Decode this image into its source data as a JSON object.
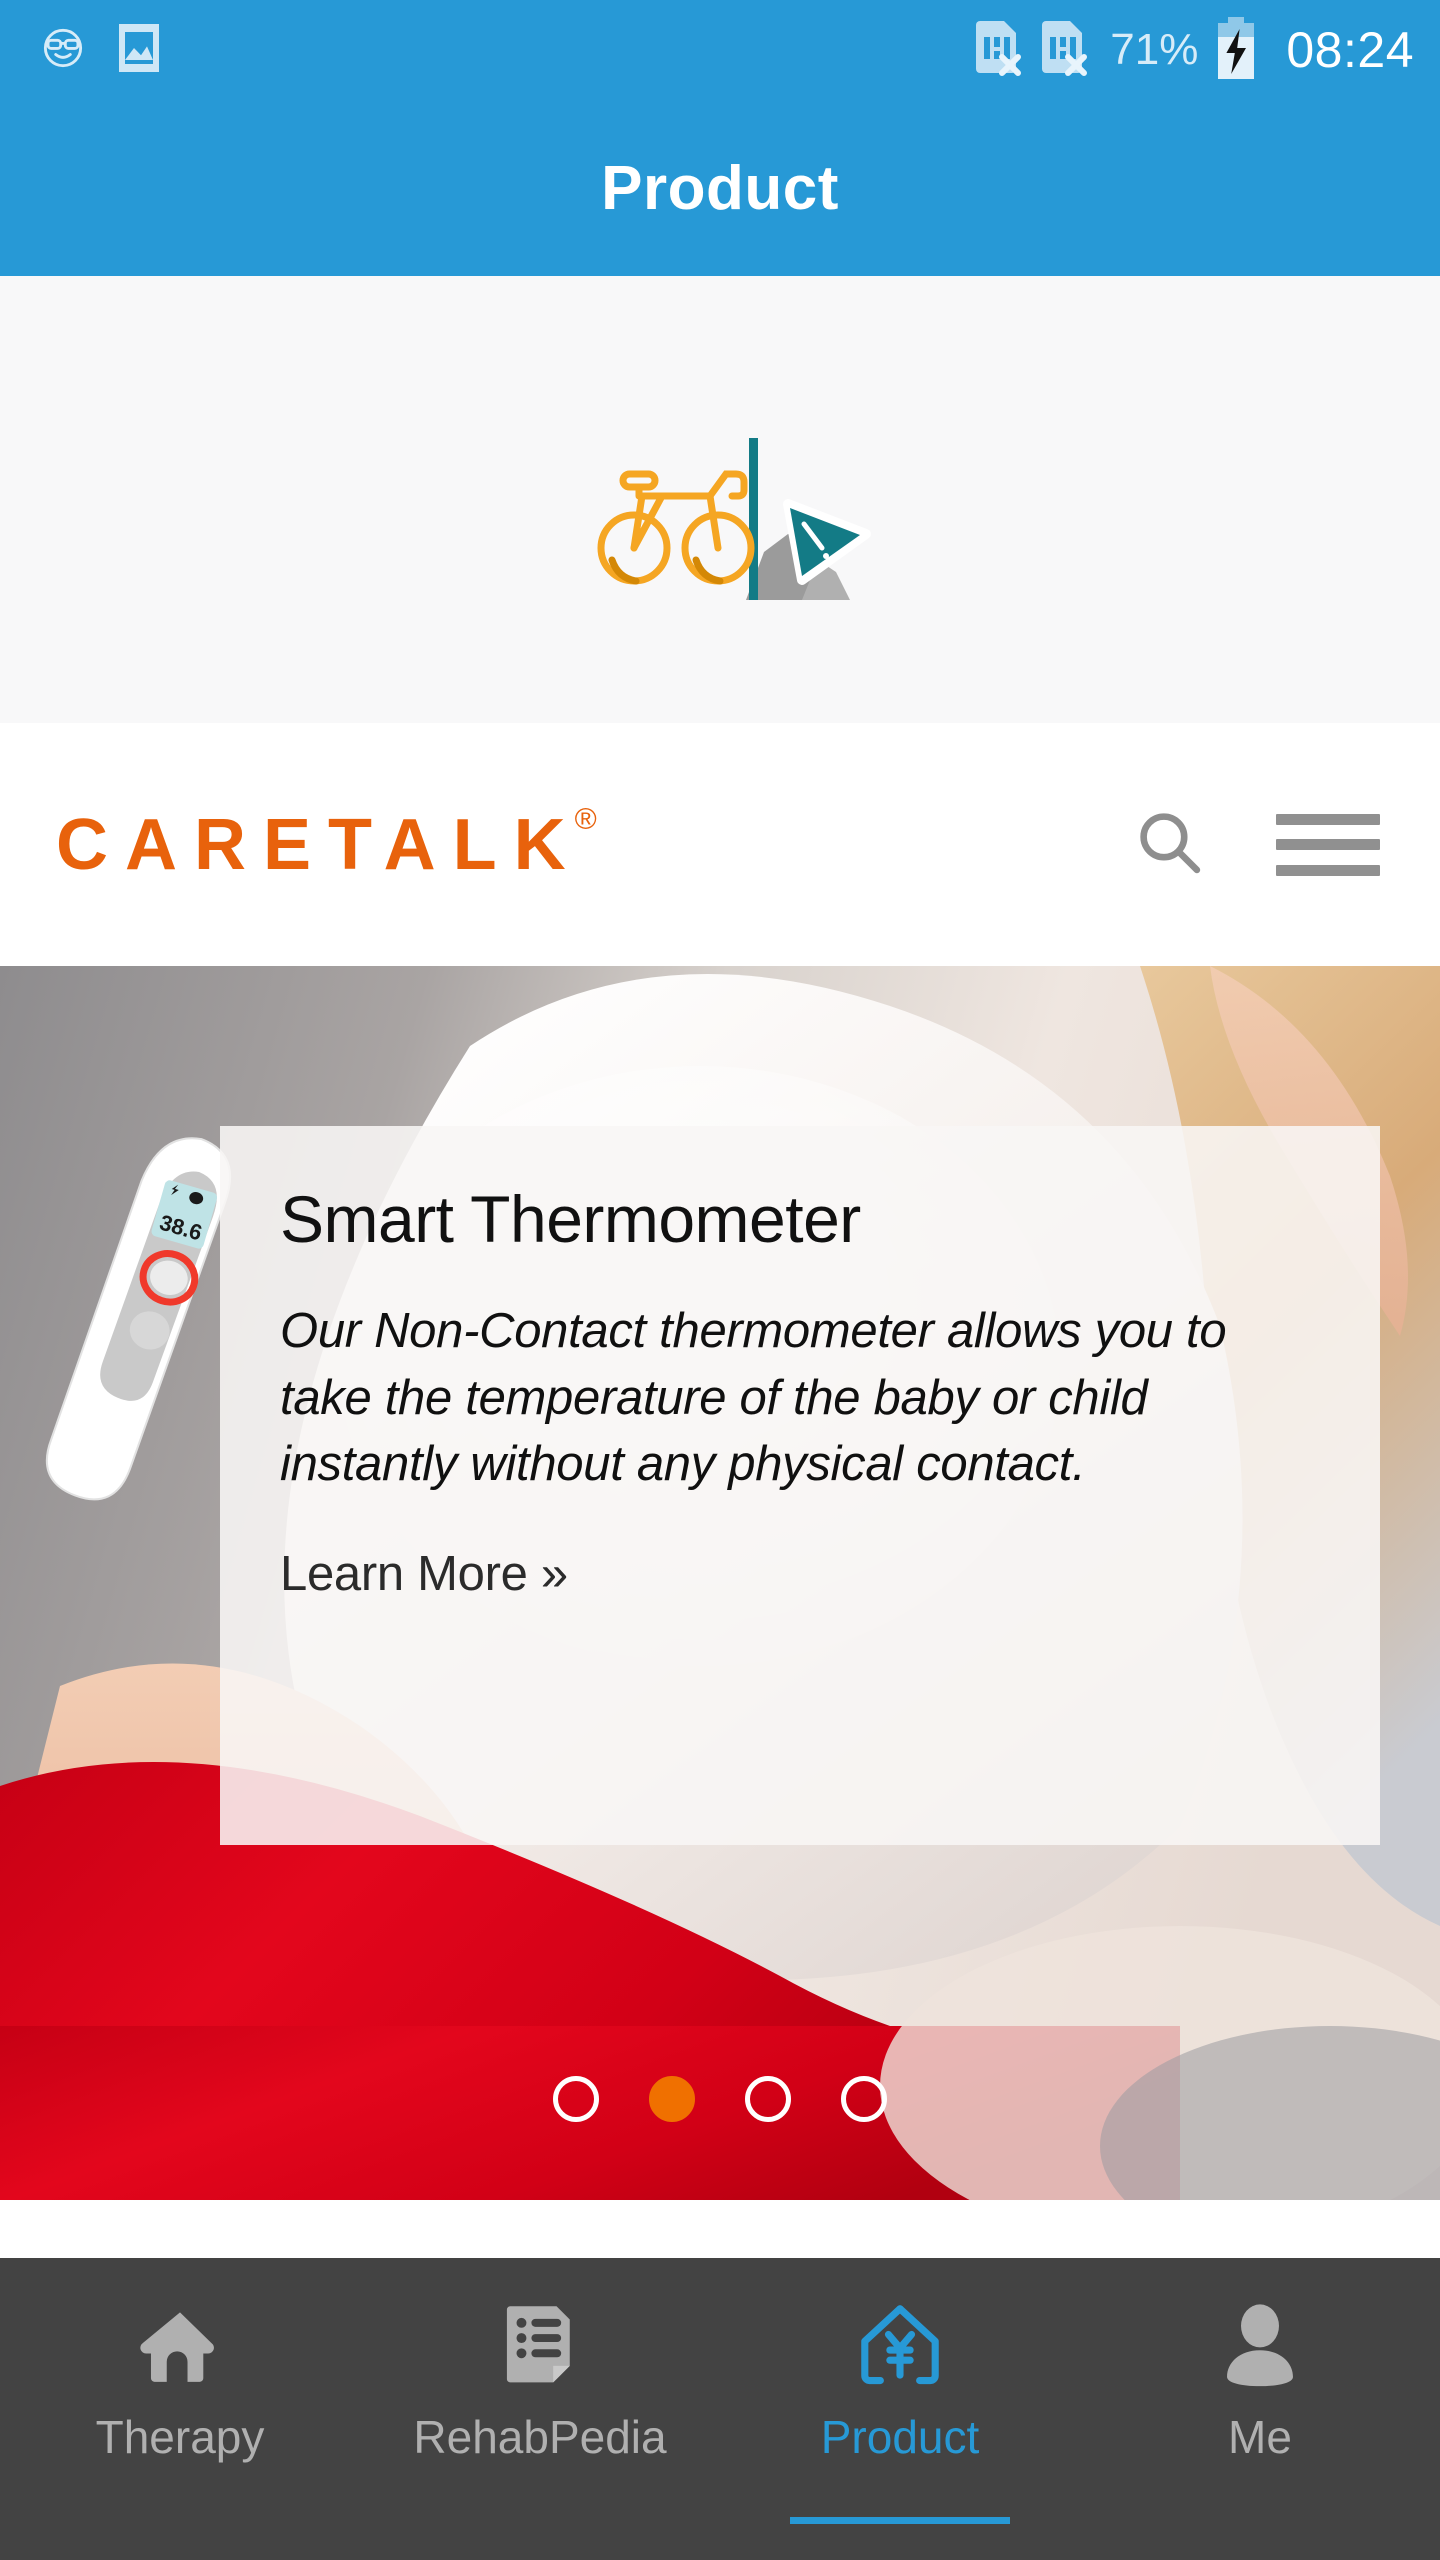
{
  "status_bar": {
    "left_icons": [
      {
        "name": "sunglasses-smiley-icon",
        "label": "sunglasses-smiley"
      },
      {
        "name": "screenshot-photo-icon",
        "label": "screenshot-photo"
      }
    ],
    "sim1_icon": "sim-card-no-service-icon",
    "sim2_icon": "sim-card-no-service-icon",
    "battery_percent": "71%",
    "battery_icon": "battery-charging-icon",
    "clock": "08:24",
    "bg_color": "#2799d6"
  },
  "app_bar": {
    "title": "Product",
    "bg_color": "#2799d6",
    "text_color": "#ffffff"
  },
  "broken_image": {
    "icon_name": "broken-image-placeholder-icon",
    "bg_color": "#f8f8f9",
    "bicycle_color": "#f5a623",
    "pole_color": "#137b86",
    "rock_color": "#9b9b9b",
    "triangle_color": "#137b86"
  },
  "site_header": {
    "brand": "CARETALK",
    "brand_mark": "®",
    "brand_color": "#e8620c",
    "search_icon": "search-icon",
    "menu_icon": "hamburger-menu-icon",
    "icon_color": "#909090"
  },
  "hero": {
    "title": "Smart Thermometer",
    "description": "Our Non-Contact thermometer allows you to take the temperature of the baby or child instantly without any physical contact.",
    "link_label": "Learn More »",
    "product_image_alt": "non-contact-thermometer",
    "card_bg": "rgba(248,246,245,0.88)",
    "carousel": {
      "total": 4,
      "active_index": 1,
      "active_color": "#f07000",
      "inactive_border_color": "#ffffff"
    }
  },
  "bottom_nav": {
    "bg_color": "#434343",
    "active_color": "#2799d6",
    "inactive_color": "#b0b0b0",
    "items": [
      {
        "label": "Therapy",
        "icon": "home-icon",
        "active": false
      },
      {
        "label": "RehabPedia",
        "icon": "document-list-icon",
        "active": false
      },
      {
        "label": "Product",
        "icon": "house-yen-icon",
        "active": true
      },
      {
        "label": "Me",
        "icon": "person-icon",
        "active": false
      }
    ]
  }
}
